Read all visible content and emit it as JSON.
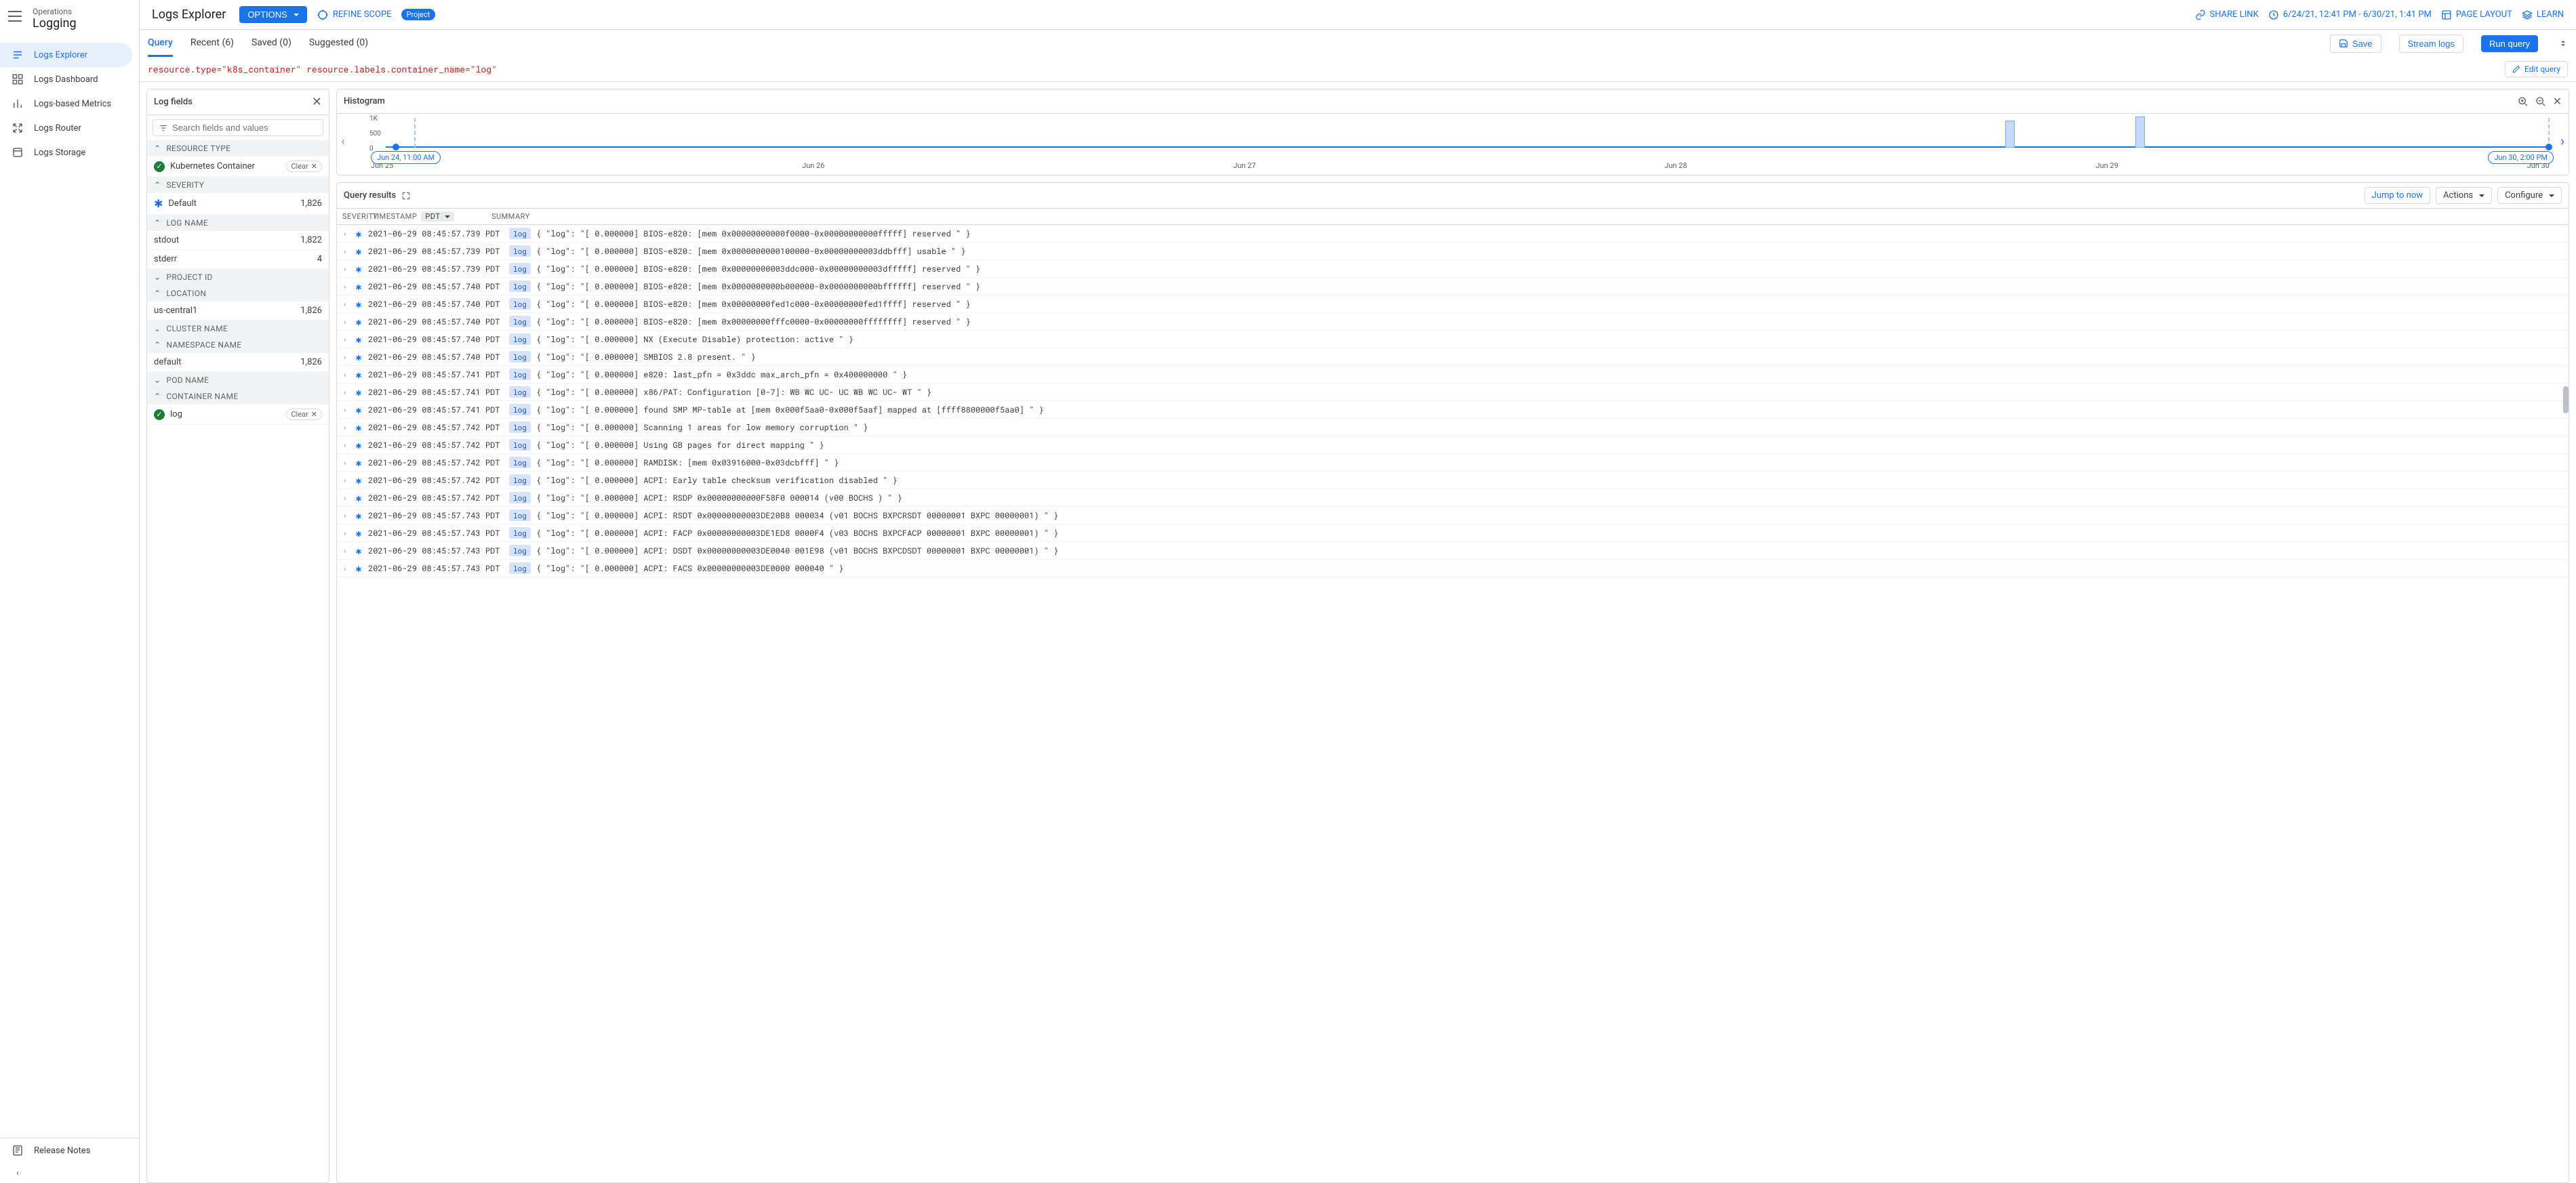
{
  "sidebar": {
    "ops": "Operations",
    "title": "Logging",
    "items": [
      {
        "label": "Logs Explorer"
      },
      {
        "label": "Logs Dashboard"
      },
      {
        "label": "Logs-based Metrics"
      },
      {
        "label": "Logs Router"
      },
      {
        "label": "Logs Storage"
      }
    ],
    "release_notes": "Release Notes"
  },
  "topbar": {
    "title": "Logs Explorer",
    "options": "OPTIONS",
    "refine": "REFINE SCOPE",
    "scope_chip": "Project",
    "share": "SHARE LINK",
    "time_range": "6/24/21, 12:41 PM - 6/30/21, 1:41 PM",
    "page_layout": "PAGE LAYOUT",
    "learn": "LEARN"
  },
  "querybar": {
    "tabs": [
      {
        "label": "Query",
        "active": true
      },
      {
        "label": "Recent (6)"
      },
      {
        "label": "Saved (0)"
      },
      {
        "label": "Suggested (0)"
      }
    ],
    "save": "Save",
    "stream": "Stream logs",
    "run": "Run query",
    "query_text": "resource.type=\"k8s_container\" resource.labels.container_name=\"log\"",
    "edit": "Edit query"
  },
  "logfields": {
    "title": "Log fields",
    "search_placeholder": "Search fields and values",
    "groups": [
      {
        "name": "RESOURCE TYPE",
        "open": true,
        "rows": [
          {
            "label": "Kubernetes Container",
            "checked": true,
            "clear": "Clear"
          }
        ]
      },
      {
        "name": "SEVERITY",
        "open": true,
        "rows": [
          {
            "label": "Default",
            "count": "1,826",
            "asterisk": true
          }
        ]
      },
      {
        "name": "LOG NAME",
        "open": true,
        "rows": [
          {
            "label": "stdout",
            "count": "1,822"
          },
          {
            "label": "stderr",
            "count": "4"
          }
        ]
      },
      {
        "name": "PROJECT ID",
        "open": false,
        "rows": []
      },
      {
        "name": "LOCATION",
        "open": true,
        "rows": [
          {
            "label": "us-central1",
            "count": "1,826"
          }
        ]
      },
      {
        "name": "CLUSTER NAME",
        "open": false,
        "rows": []
      },
      {
        "name": "NAMESPACE NAME",
        "open": true,
        "rows": [
          {
            "label": "default",
            "count": "1,826"
          }
        ]
      },
      {
        "name": "POD NAME",
        "open": false,
        "rows": []
      },
      {
        "name": "CONTAINER NAME",
        "open": true,
        "rows": [
          {
            "label": "log",
            "checked": true,
            "clear": "Clear"
          }
        ]
      }
    ]
  },
  "histogram": {
    "title": "Histogram",
    "yticks": [
      "1K",
      "500",
      "0"
    ],
    "xlabels": [
      "Jun 25",
      "Jun 26",
      "Jun 27",
      "Jun 28",
      "Jun 29",
      "Jun 30"
    ],
    "start_pill": "Jun 24, 11:00 AM",
    "end_pill": "Jun 30, 2:00 PM"
  },
  "chart_data": {
    "type": "bar",
    "title": "Histogram",
    "ylim": [
      0,
      1000
    ],
    "yticks": [
      0,
      500,
      1000
    ],
    "categories": [
      "Jun 25",
      "Jun 26",
      "Jun 27",
      "Jun 28",
      "Jun 29",
      "Jun 30"
    ],
    "bars": [
      {
        "x": "between Jun 28 and Jun 29",
        "approx_value": 900
      },
      {
        "x": "Jun 29",
        "approx_value": 1000
      }
    ],
    "range_start": "Jun 24, 11:00 AM",
    "range_end": "Jun 30, 2:00 PM"
  },
  "results": {
    "title": "Query results",
    "jump": "Jump to now",
    "actions": "Actions",
    "configure": "Configure",
    "cols": {
      "severity": "SEVERITY",
      "timestamp": "TIMESTAMP",
      "tz": "PDT",
      "summary": "SUMMARY"
    },
    "tag": "log",
    "rows": [
      {
        "ts": "2021-06-29 08:45:57.739 PDT",
        "msg": "{ \"log\": \"[ 0.000000] BIOS-e820: [mem 0x00000000000f0000-0x00000000000fffff] reserved \" }"
      },
      {
        "ts": "2021-06-29 08:45:57.739 PDT",
        "msg": "{ \"log\": \"[ 0.000000] BIOS-e820: [mem 0x0000000000100000-0x00000000003ddbfff] usable \" }"
      },
      {
        "ts": "2021-06-29 08:45:57.739 PDT",
        "msg": "{ \"log\": \"[ 0.000000] BIOS-e820: [mem 0x00000000003ddc000-0x00000000003dfffff] reserved \" }"
      },
      {
        "ts": "2021-06-29 08:45:57.740 PDT",
        "msg": "{ \"log\": \"[ 0.000000] BIOS-e820: [mem 0x0000000000b000000-0x0000000000bffffff] reserved \" }"
      },
      {
        "ts": "2021-06-29 08:45:57.740 PDT",
        "msg": "{ \"log\": \"[ 0.000000] BIOS-e820: [mem 0x00000000fed1c000-0x00000000fed1ffff] reserved \" }"
      },
      {
        "ts": "2021-06-29 08:45:57.740 PDT",
        "msg": "{ \"log\": \"[ 0.000000] BIOS-e820: [mem 0x00000000fffc0000-0x00000000ffffffff] reserved \" }"
      },
      {
        "ts": "2021-06-29 08:45:57.740 PDT",
        "msg": "{ \"log\": \"[ 0.000000] NX (Execute Disable) protection: active \" }"
      },
      {
        "ts": "2021-06-29 08:45:57.740 PDT",
        "msg": "{ \"log\": \"[ 0.000000] SMBIOS 2.8 present. \" }"
      },
      {
        "ts": "2021-06-29 08:45:57.741 PDT",
        "msg": "{ \"log\": \"[ 0.000000] e820: last_pfn = 0x3ddc max_arch_pfn = 0x400000000 \" }"
      },
      {
        "ts": "2021-06-29 08:45:57.741 PDT",
        "msg": "{ \"log\": \"[ 0.000000] x86/PAT: Configuration [0-7]: WB WC UC- UC WB WC UC- WT \" }"
      },
      {
        "ts": "2021-06-29 08:45:57.741 PDT",
        "msg": "{ \"log\": \"[ 0.000000] found SMP MP-table at [mem 0x000f5aa0-0x000f5aaf] mapped at [ffff8800000f5aa0] \" }"
      },
      {
        "ts": "2021-06-29 08:45:57.742 PDT",
        "msg": "{ \"log\": \"[ 0.000000] Scanning 1 areas for low memory corruption \" }"
      },
      {
        "ts": "2021-06-29 08:45:57.742 PDT",
        "msg": "{ \"log\": \"[ 0.000000] Using GB pages for direct mapping \" }"
      },
      {
        "ts": "2021-06-29 08:45:57.742 PDT",
        "msg": "{ \"log\": \"[ 0.000000] RAMDISK: [mem 0x03916000-0x03dcbfff] \" }"
      },
      {
        "ts": "2021-06-29 08:45:57.742 PDT",
        "msg": "{ \"log\": \"[ 0.000000] ACPI: Early table checksum verification disabled \" }"
      },
      {
        "ts": "2021-06-29 08:45:57.742 PDT",
        "msg": "{ \"log\": \"[ 0.000000] ACPI: RSDP 0x00000000000F58F0 000014 (v00 BOCHS ) \" }"
      },
      {
        "ts": "2021-06-29 08:45:57.743 PDT",
        "msg": "{ \"log\": \"[ 0.000000] ACPI: RSDT 0x00000000003DE20B8 000034 (v01 BOCHS BXPCRSDT 00000001 BXPC 00000001) \" }"
      },
      {
        "ts": "2021-06-29 08:45:57.743 PDT",
        "msg": "{ \"log\": \"[ 0.000000] ACPI: FACP 0x00000000003DE1ED8 0000F4 (v03 BOCHS BXPCFACP 00000001 BXPC 00000001) \" }"
      },
      {
        "ts": "2021-06-29 08:45:57.743 PDT",
        "msg": "{ \"log\": \"[ 0.000000] ACPI: DSDT 0x00000000003DE0040 001E98 (v01 BOCHS BXPCDSDT 00000001 BXPC 00000001) \" }"
      },
      {
        "ts": "2021-06-29 08:45:57.743 PDT",
        "msg": "{ \"log\": \"[ 0.000000] ACPI: FACS 0x00000000003DE0000 000040 \" }"
      }
    ]
  }
}
